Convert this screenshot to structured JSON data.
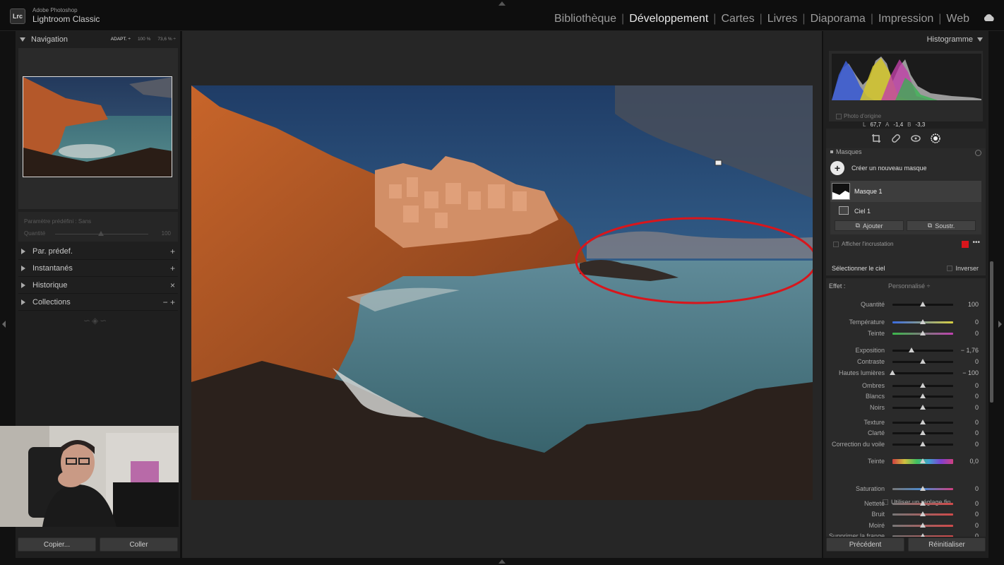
{
  "app": {
    "brand_top": "Adobe Photoshop",
    "brand_bottom": "Lightroom Classic",
    "logo": "Lrc"
  },
  "modules": [
    {
      "label": "Bibliothèque",
      "active": false
    },
    {
      "label": "Développement",
      "active": true
    },
    {
      "label": "Cartes",
      "active": false
    },
    {
      "label": "Livres",
      "active": false
    },
    {
      "label": "Diaporama",
      "active": false
    },
    {
      "label": "Impression",
      "active": false
    },
    {
      "label": "Web",
      "active": false
    }
  ],
  "left": {
    "navigation": "Navigation",
    "zoom": [
      "ADAPT. ÷",
      "100 %",
      "73,6 % ÷"
    ],
    "preset_label": "Paramètre prédéfini : Sans",
    "quantity_label": "Quantité",
    "quantity_value": "100",
    "panels": [
      {
        "label": "Par. prédef.",
        "action": "+"
      },
      {
        "label": "Instantanés",
        "action": "+"
      },
      {
        "label": "Historique",
        "action": "×"
      },
      {
        "label": "Collections",
        "action": "− +"
      }
    ],
    "copy_button": "Copier...",
    "paste_button": "Coller"
  },
  "right": {
    "histogram_title": "Histogramme",
    "hist_l_label": "L",
    "hist_l": "67,7",
    "hist_a_label": "A",
    "hist_a": "-1,4",
    "hist_b_label": "B",
    "hist_b": "-3,3",
    "original_photo": "Photo d'origine",
    "masks_title": "Masques",
    "create_mask": "Créer un nouveau masque",
    "mask1": "Masque 1",
    "sky": "Ciel 1",
    "add": "Ajouter",
    "subtract": "Soustr.",
    "show_overlay": "Afficher l'incrustation",
    "overlay_color": "#d8161c",
    "select_sky": "Sélectionner le ciel",
    "invert": "Inverser",
    "effect_label": "Effet :",
    "effect_value": "Personnalisé ÷",
    "fine_adjust": "Utiliser un réglage fin",
    "sliders": [
      {
        "label": "Quantité",
        "value": "100",
        "pos": 0.5
      },
      {
        "label": "Température",
        "value": "0",
        "pos": 0.5
      },
      {
        "label": "Teinte",
        "value": "0",
        "pos": 0.5
      },
      {
        "label": "Exposition",
        "value": "− 1,76",
        "pos": 0.31
      },
      {
        "label": "Contraste",
        "value": "0",
        "pos": 0.5
      },
      {
        "label": "Hautes lumières",
        "value": "− 100",
        "pos": 0.0
      },
      {
        "label": "Ombres",
        "value": "0",
        "pos": 0.5
      },
      {
        "label": "Blancs",
        "value": "0",
        "pos": 0.5
      },
      {
        "label": "Noirs",
        "value": "0",
        "pos": 0.5
      },
      {
        "label": "Texture",
        "value": "0",
        "pos": 0.5
      },
      {
        "label": "Clarté",
        "value": "0",
        "pos": 0.5
      },
      {
        "label": "Correction du voile",
        "value": "0",
        "pos": 0.5
      },
      {
        "label": "Teinte",
        "value": "0,0",
        "pos": 0.5
      },
      {
        "label": "Saturation",
        "value": "0",
        "pos": 0.5
      },
      {
        "label": "Netteté",
        "value": "0",
        "pos": 0.5
      },
      {
        "label": "Bruit",
        "value": "0",
        "pos": 0.5
      },
      {
        "label": "Moiré",
        "value": "0",
        "pos": 0.5
      },
      {
        "label": "Supprimer la frange",
        "value": "0",
        "pos": 0.5
      }
    ],
    "previous_button": "Précédent",
    "reset_button": "Réinitialiser"
  }
}
